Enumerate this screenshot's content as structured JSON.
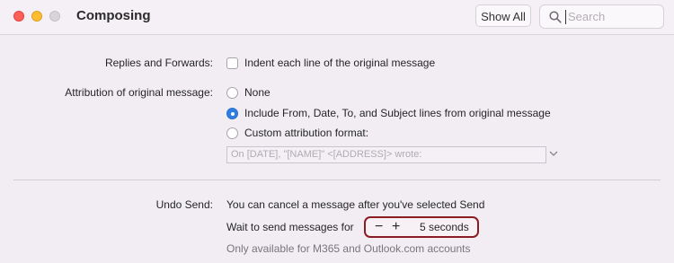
{
  "window": {
    "title": "Composing",
    "show_all_label": "Show All",
    "search_placeholder": "Search"
  },
  "replies": {
    "label": "Replies and Forwards:",
    "indent_option": "Indent each line of the original message",
    "indent_checked": false
  },
  "attribution": {
    "label": "Attribution of original message:",
    "options": [
      {
        "label": "None",
        "selected": false
      },
      {
        "label": "Include From, Date, To, and Subject lines from original message",
        "selected": true
      },
      {
        "label": "Custom attribution format:",
        "selected": false
      }
    ],
    "format_value": "On [DATE], \"[NAME]\" <[ADDRESS]> wrote:"
  },
  "undo_send": {
    "label": "Undo Send:",
    "description": "You can cancel a message after you've selected Send",
    "wait_label": "Wait to send messages for",
    "minus": "−",
    "plus": "+",
    "value": "5 seconds",
    "note": "Only available for M365 and Outlook.com accounts",
    "highlight_color": "#8b1c22"
  },
  "colors": {
    "accent": "#2f7de1",
    "close": "#ff5f57",
    "minimize": "#febc2e"
  }
}
